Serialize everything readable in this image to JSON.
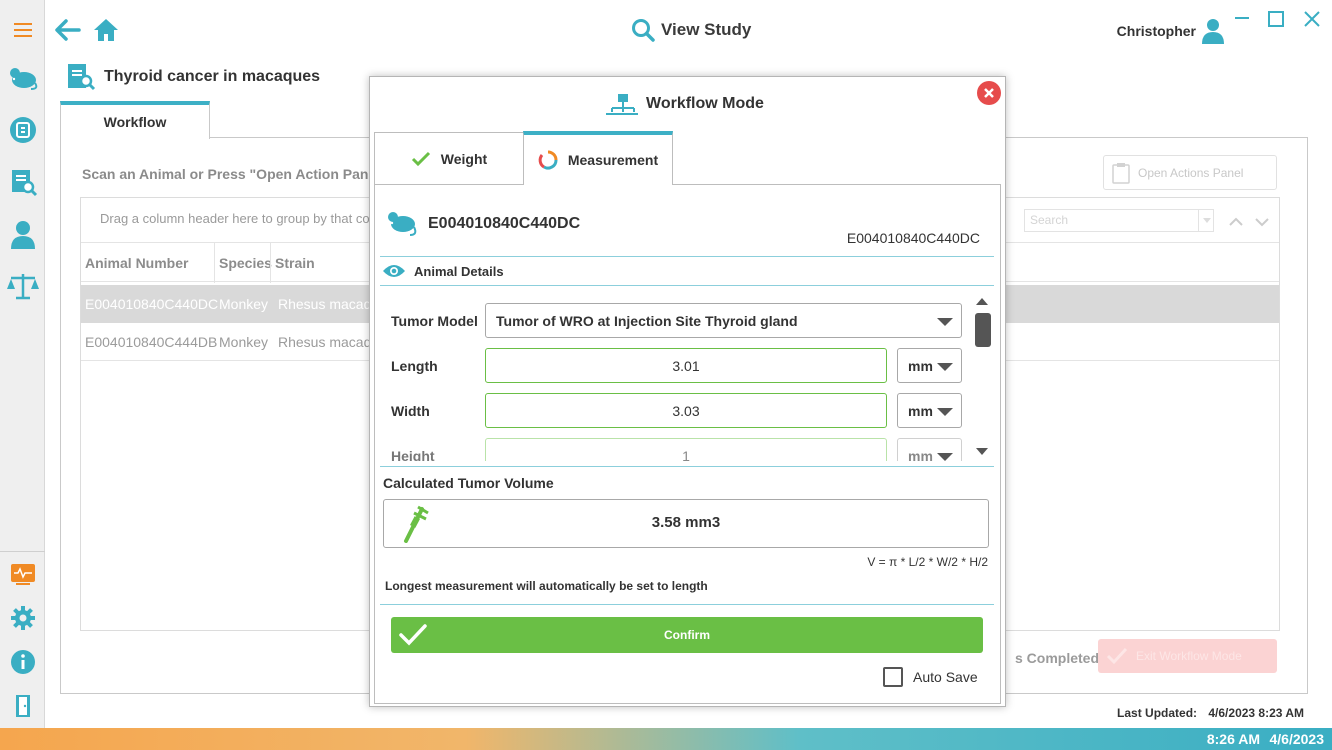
{
  "window": {
    "title": "View Study",
    "user": "Christopher"
  },
  "page": {
    "heading": "Thyroid cancer in macaques"
  },
  "main": {
    "tab_label": "Workflow",
    "scan_prompt": "Scan an Animal or Press \"Open Action Panel\"",
    "open_actions_label": "Open Actions Panel",
    "group_hint": "Drag a column header here to group by that co",
    "search_placeholder": "Search",
    "columns": [
      "Animal Number",
      "Species",
      "Strain"
    ],
    "rows": [
      {
        "animal_number": "E004010840C440DC",
        "species": "Monkey",
        "strain": "Rhesus macaqu"
      },
      {
        "animal_number": "E004010840C444DB",
        "species": "Monkey",
        "strain": "Rhesus macaqu"
      }
    ],
    "completed_text": "s Completed!",
    "exit_label": "Exit Workflow Mode",
    "last_updated_label": "Last Updated:",
    "last_updated_value": "4/6/2023 8:23 AM"
  },
  "taskbar": {
    "time": "8:26 AM",
    "date": "4/6/2023"
  },
  "modal": {
    "title": "Workflow Mode",
    "tabs": [
      {
        "label": "Weight",
        "icon": "checkmark-icon"
      },
      {
        "label": "Measurement",
        "icon": "progress-ring-icon"
      }
    ],
    "animal_id": "E004010840C440DC",
    "animal_id_right": "E004010840C440DC",
    "details_label": "Animal Details",
    "fields": {
      "tumor_model_label": "Tumor Model",
      "tumor_model_value": "Tumor of WRO at Injection Site Thyroid gland",
      "length_label": "Length",
      "length_value": "3.01",
      "length_unit": "mm",
      "width_label": "Width",
      "width_value": "3.03",
      "width_unit": "mm",
      "height_label": "Height",
      "height_value": "1",
      "height_unit": "mm"
    },
    "calc_label": "Calculated Tumor Volume",
    "calc_value": "3.58 mm3",
    "formula": "V = π * L/2 * W/2 * H/2",
    "longest_note": "Longest measurement will automatically be set to length",
    "confirm_label": "Confirm",
    "autosave_label": "Auto Save"
  },
  "colors": {
    "accent": "#3db0c6",
    "confirm": "#6abf45",
    "close": "#e64c4c",
    "menu": "#f08a24"
  }
}
